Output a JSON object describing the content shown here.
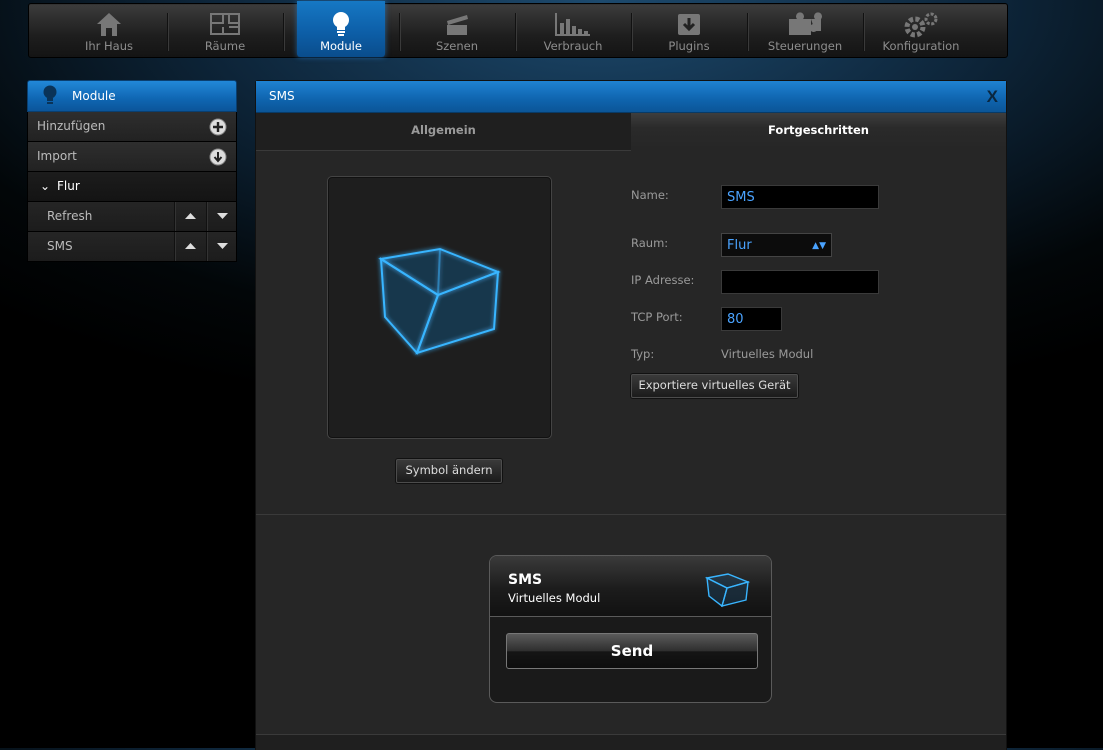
{
  "nav": {
    "items": [
      {
        "label": "Ihr Haus",
        "icon": "house-icon"
      },
      {
        "label": "Räume",
        "icon": "floorplan-icon"
      },
      {
        "label": "Module",
        "icon": "lightbulb-icon",
        "active": true
      },
      {
        "label": "Szenen",
        "icon": "clapperboard-icon"
      },
      {
        "label": "Verbrauch",
        "icon": "bar-chart-icon"
      },
      {
        "label": "Plugins",
        "icon": "download-box-icon"
      },
      {
        "label": "Steuerungen",
        "icon": "puzzle-icon"
      },
      {
        "label": "Konfiguration",
        "icon": "gears-icon"
      }
    ]
  },
  "sidebar": {
    "title": "Module",
    "add_label": "Hinzufügen",
    "import_label": "Import",
    "group_label": "Flur",
    "modules": [
      {
        "label": "Refresh"
      },
      {
        "label": "SMS"
      }
    ]
  },
  "dialog": {
    "title": "SMS",
    "close_label": "X",
    "tabs": {
      "general": "Allgemein",
      "advanced": "Fortgeschritten"
    },
    "change_symbol_label": "Symbol ändern",
    "fields": {
      "name_label": "Name:",
      "name_value": "SMS",
      "room_label": "Raum:",
      "room_value": "Flur",
      "ip_label": "IP Adresse:",
      "ip_value": "",
      "port_label": "TCP Port:",
      "port_value": "80",
      "type_label": "Typ:",
      "type_value": "Virtuelles Modul"
    },
    "export_label": "Exportiere virtuelles Gerät",
    "widget": {
      "title": "SMS",
      "subtitle": "Virtuelles Modul",
      "send_label": "Send"
    }
  },
  "colors": {
    "accent_blue": "#0f66b2",
    "input_text": "#4aa3ff",
    "panel_bg": "#262626"
  }
}
